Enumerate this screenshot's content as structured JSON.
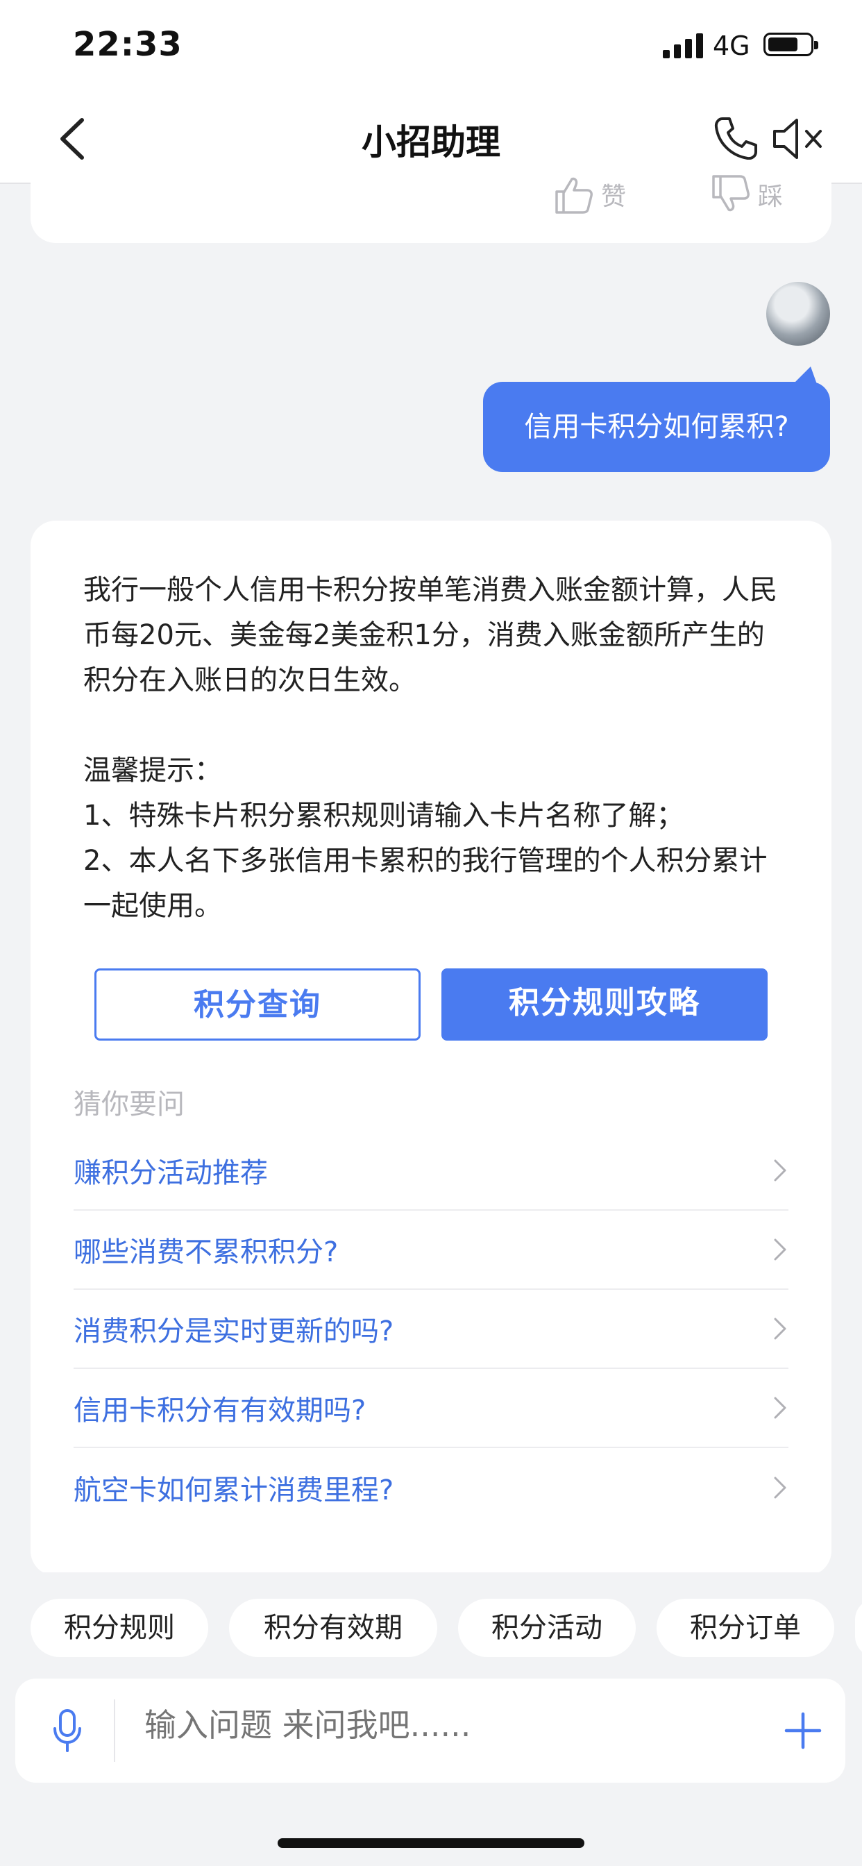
{
  "status": {
    "time": "22:33",
    "network": "4G"
  },
  "nav": {
    "title": "小招助理"
  },
  "feedback": {
    "like": "赞",
    "dislike": "踩"
  },
  "user_message": "信用卡积分如何累积?",
  "answer": {
    "paragraph1": "我行一般个人信用卡积分按单笔消费入账金额计算，人民币每20元、美金每2美金积1分，消费入账金额所产生的积分在入账日的次日生效。",
    "tip_title": "温馨提示：",
    "tip1": "1、特殊卡片积分累积规则请输入卡片名称了解；",
    "tip2": "2、本人名下多张信用卡累积的我行管理的个人积分累计一起使用。"
  },
  "buttons": {
    "query": "积分查询",
    "rules": "积分规则攻略"
  },
  "guess_title": "猜你要问",
  "questions": [
    "赚积分活动推荐",
    "哪些消费不累积积分?",
    "消费积分是实时更新的吗?",
    "信用卡积分有有效期吗?",
    "航空卡如何累计消费里程?"
  ],
  "tags": [
    "积分规则",
    "积分有效期",
    "积分活动",
    "积分订单"
  ],
  "input": {
    "placeholder": "输入问题 来问我吧......"
  },
  "icons": {
    "back": "chevron-left-icon",
    "phone": "phone-icon",
    "mute": "speaker-muted-icon",
    "like": "thumbs-up-icon",
    "dislike": "thumbs-down-icon",
    "mic": "microphone-icon",
    "plus": "plus-icon",
    "chevron": "chevron-right-icon"
  },
  "colors": {
    "accent": "#4a7bf0",
    "link": "#3d6fe0",
    "background": "#f2f3f5"
  }
}
